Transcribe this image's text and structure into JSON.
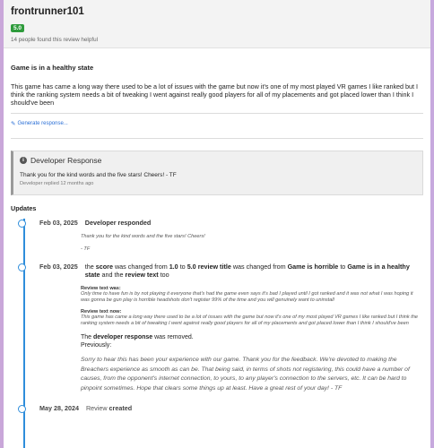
{
  "review": {
    "username": "frontrunner101",
    "rating": "5.0",
    "helpful_text": "14 people found this review helpful",
    "title": "Game is in a healthy state",
    "text": "This game has came a long way there used to be a lot of issues with the game but now it's one of my most played VR games I like ranked but I think the ranking system needs a bit of tweaking I went against really good players for all of my placements and got placed lower than I think I should've been",
    "generate_link": "Generate response...",
    "icon": "magic-wand-icon"
  },
  "developer_response": {
    "heading": "Developer Response",
    "icon": "info-circle-icon",
    "text": "Thank you for the kind words and the five stars! Cheers! - TF",
    "meta": "Developer replied 12 months ago"
  },
  "updates": {
    "title": "Updates",
    "items": [
      {
        "date": "Feb 03, 2025",
        "event": "Developer responded",
        "quote_line1": "Thank you for the kind words and the five stars! Cheers!",
        "quote_line2": "- TF"
      },
      {
        "date": "Feb 03, 2025",
        "change_parts": [
          "the",
          "score",
          "was changed from",
          "1.0",
          "to",
          "5.0",
          "review title",
          "was changed from",
          "Game is horrible",
          "to",
          "Game is in a healthy state",
          "and the",
          "review text",
          "too"
        ],
        "old_label": "Review text was:",
        "old_text": "Only time to have fun is by not playing it everyone that's had the game even says it's bad I played until I got ranked and it was not what I was hoping it was gonna be gun play is horrible headshots don't register 99% of the time and you will genuinely want to uninstall",
        "new_label": "Review text now:",
        "new_text": "This game has came a long way there used to be a lot of issues with the game but now it's one of my most played VR games I like ranked but I think the ranking system needs a bit of tweaking I went against really good players for all of my placements and got placed lower than I think I should've been",
        "removed_pre": "The",
        "removed_bold": "developer response",
        "removed_post": "was removed.",
        "previously": "Previously:",
        "old_dev_text": "Sorry to hear this has been your experience with our game. Thank you for the feedback. We're devoted to making the Breachers experience as smooth as can be. That being said, in terms of shots not registering, this could have a number of causes, from the opponent's internet connection, to yours, to any player's connection to the servers, etc. It can be hard to pinpoint sometimes. Hope that clears some things up at least. Have a great rest of your day! - TF"
      },
      {
        "date": "May 28, 2024",
        "created_pre": "Review",
        "created_bold": "created"
      }
    ]
  },
  "colors": {
    "accent": "#2e8ddb",
    "rating_green": "#2e9b3c",
    "link": "#2a6fd6"
  }
}
